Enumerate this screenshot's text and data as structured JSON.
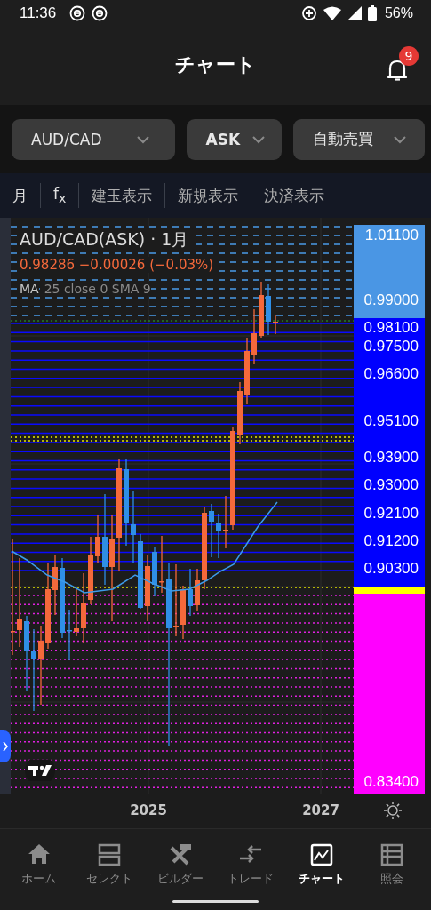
{
  "status_bar": {
    "time": "11:36",
    "battery": "56%"
  },
  "header": {
    "title": "チャート",
    "notification_count": "9"
  },
  "pickers": [
    {
      "label": "AUD/CAD"
    },
    {
      "label": "ASK"
    },
    {
      "label": "自動売買"
    }
  ],
  "toolbar": [
    {
      "label": "月"
    },
    {
      "label": "f$_{x}$"
    },
    {
      "label": "建玉表示"
    },
    {
      "label": "新規表示"
    },
    {
      "label": "決済表示"
    }
  ],
  "chart": {
    "legend_title": "AUD/CAD(ASK) · 1月",
    "quote": "0.98286 −0.00026 (−0.03%)",
    "indicator_name": "MA",
    "indicator_params": "25 close 0 SMA 9"
  },
  "price_axis": {
    "bands": [
      {
        "color": "#4a96e4",
        "labels": [
          "1.01100",
          "0.99000"
        ]
      },
      {
        "color": "#0000ff",
        "labels": [
          "0.98100",
          "0.97500",
          "0.96600",
          "0.95100",
          "0.93900",
          "0.93000",
          "0.92100",
          "0.91200",
          "0.90300"
        ]
      },
      {
        "color": "#ffff00"
      },
      {
        "color": "#ff00ff",
        "labels": [
          "0.83400"
        ]
      }
    ]
  },
  "time_axis": {
    "labels": [
      "2025",
      "2027"
    ]
  },
  "nav": [
    {
      "label": "ホーム",
      "selected": false
    },
    {
      "label": "セレクト",
      "selected": false
    },
    {
      "label": "ビルダー",
      "selected": false
    },
    {
      "label": "トレード",
      "selected": false
    },
    {
      "label": "チャート",
      "selected": true
    },
    {
      "label": "照会",
      "selected": false
    }
  ]
}
